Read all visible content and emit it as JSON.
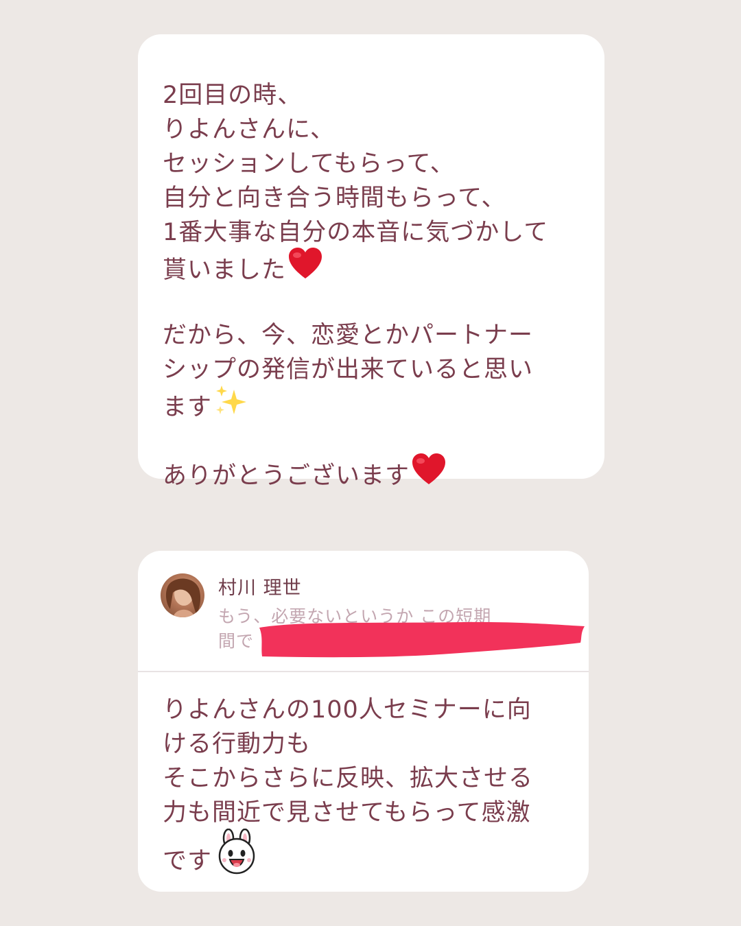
{
  "message_1": {
    "lines": [
      "2回目の時、",
      "りよんさんに、",
      "セッションしてもらって、",
      "自分と向き合う時間もらって、",
      "1番大事な自分の本音に気づかして",
      "貰いました",
      "",
      "だから、今、恋愛とかパートナー",
      "シップの発信が出来ていると思い",
      "ます",
      "",
      "ありがとうございます"
    ],
    "emoji": [
      "red-heart",
      "sparkles",
      "red-heart"
    ]
  },
  "reply": {
    "sender_name": "村川 理世",
    "preview_line_1": "もう、必要ないというか この短期",
    "preview_line_2": "間で"
  },
  "message_2": {
    "lines": [
      "りよんさんの100人セミナーに向",
      "ける行動力も",
      "そこからさらに反映、拡大させる",
      "力も間近で見させてもらって感激",
      "です"
    ],
    "emoji": [
      "bunny-sticker"
    ]
  },
  "colors": {
    "background": "#ede8e5",
    "card": "#ffffff",
    "text": "#7a3d4d",
    "preview_text": "#c3a6b0",
    "redaction": "#f2325a"
  }
}
